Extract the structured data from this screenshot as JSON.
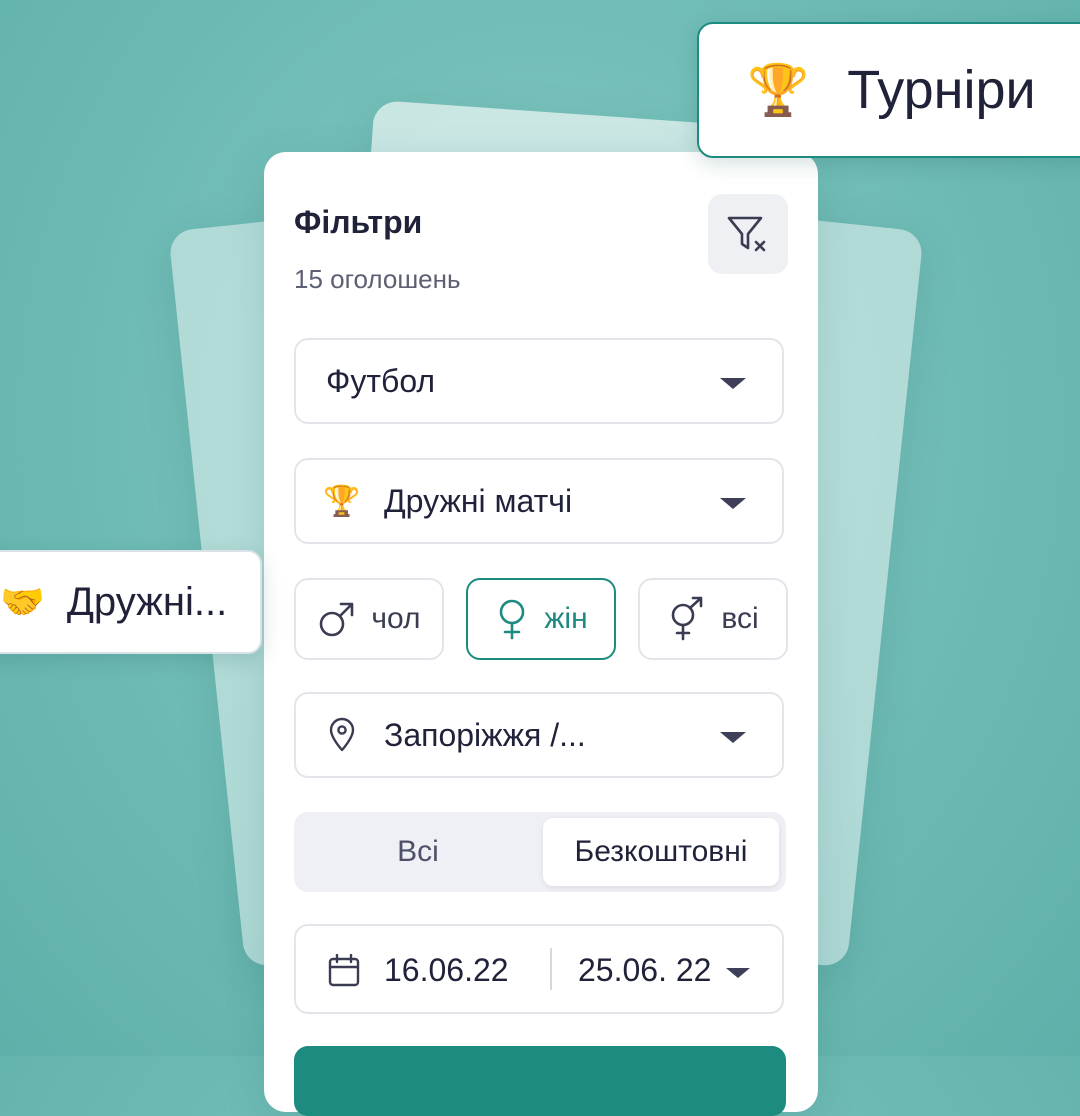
{
  "filters": {
    "title": "Фільтри",
    "count": "15 оголошень",
    "reset_icon": "filter-reset-icon",
    "sport": {
      "value": "Футбол"
    },
    "event_type": {
      "icon": "trophy-emoji",
      "icon_glyph": "🏆",
      "value": "Дружні матчі"
    },
    "gender": [
      {
        "label": "чол",
        "icon": "male-icon",
        "selected": false
      },
      {
        "label": "жін",
        "icon": "female-icon",
        "selected": true
      },
      {
        "label": "всі",
        "icon": "gender-all-icon",
        "selected": false
      }
    ],
    "location": {
      "icon": "location-pin-icon",
      "value": "Запоріжжя /..."
    },
    "price": {
      "options": [
        "Всі",
        "Безкоштовні"
      ],
      "selected": "Безкоштовні"
    },
    "dates": {
      "icon": "calendar-icon",
      "from": "16.06.22",
      "to": "25.06. 22"
    }
  },
  "floating_tags": {
    "tournaments": {
      "emoji": "🏆",
      "label": "Турніри"
    },
    "friendly": {
      "emoji": "🤝",
      "label": "Дружні..."
    }
  },
  "colors": {
    "accent": "#1e8b80",
    "background": "#72bdb7",
    "text": "#1f2238"
  }
}
